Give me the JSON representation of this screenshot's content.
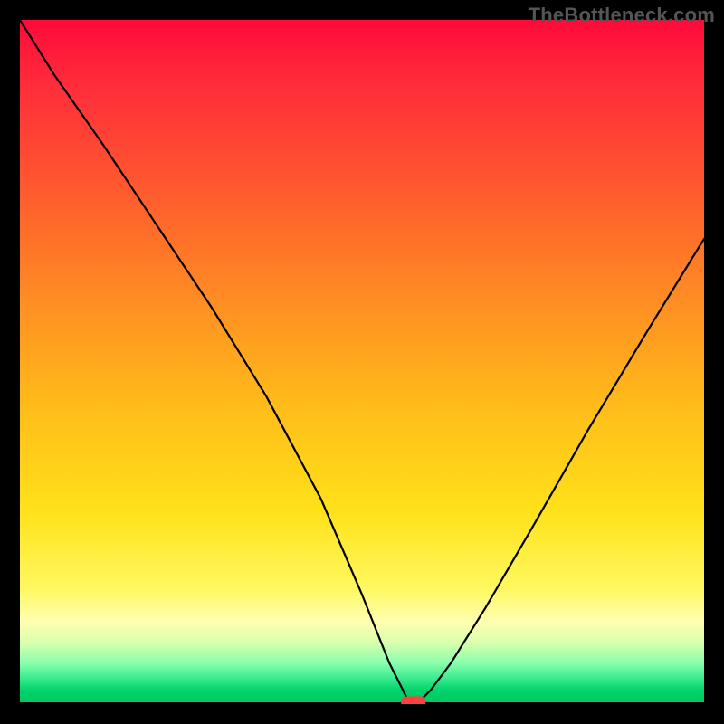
{
  "watermark": "TheBottleneck.com",
  "chart_data": {
    "type": "line",
    "title": "",
    "xlabel": "",
    "ylabel": "",
    "xlim": [
      0,
      100
    ],
    "ylim": [
      0,
      100
    ],
    "grid": false,
    "legend": false,
    "series": [
      {
        "name": "bottleneck-curve",
        "x": [
          0,
          5,
          12,
          20,
          28,
          36,
          44,
          50,
          54,
          56,
          57,
          58,
          60,
          63,
          68,
          75,
          83,
          92,
          100
        ],
        "values": [
          100,
          92,
          82,
          70,
          58,
          45,
          30,
          16,
          6,
          2,
          0,
          0,
          2,
          6,
          14,
          26,
          40,
          55,
          68
        ]
      }
    ],
    "marker": {
      "x": 57.5,
      "y": 0,
      "color": "#ff4040"
    },
    "gradient_stops": [
      {
        "pos": 0,
        "color": "#ff0a3a"
      },
      {
        "pos": 0.55,
        "color": "#ffb81a"
      },
      {
        "pos": 0.83,
        "color": "#fff860"
      },
      {
        "pos": 0.96,
        "color": "#30e88a"
      },
      {
        "pos": 1.0,
        "color": "#00c75f"
      }
    ]
  }
}
